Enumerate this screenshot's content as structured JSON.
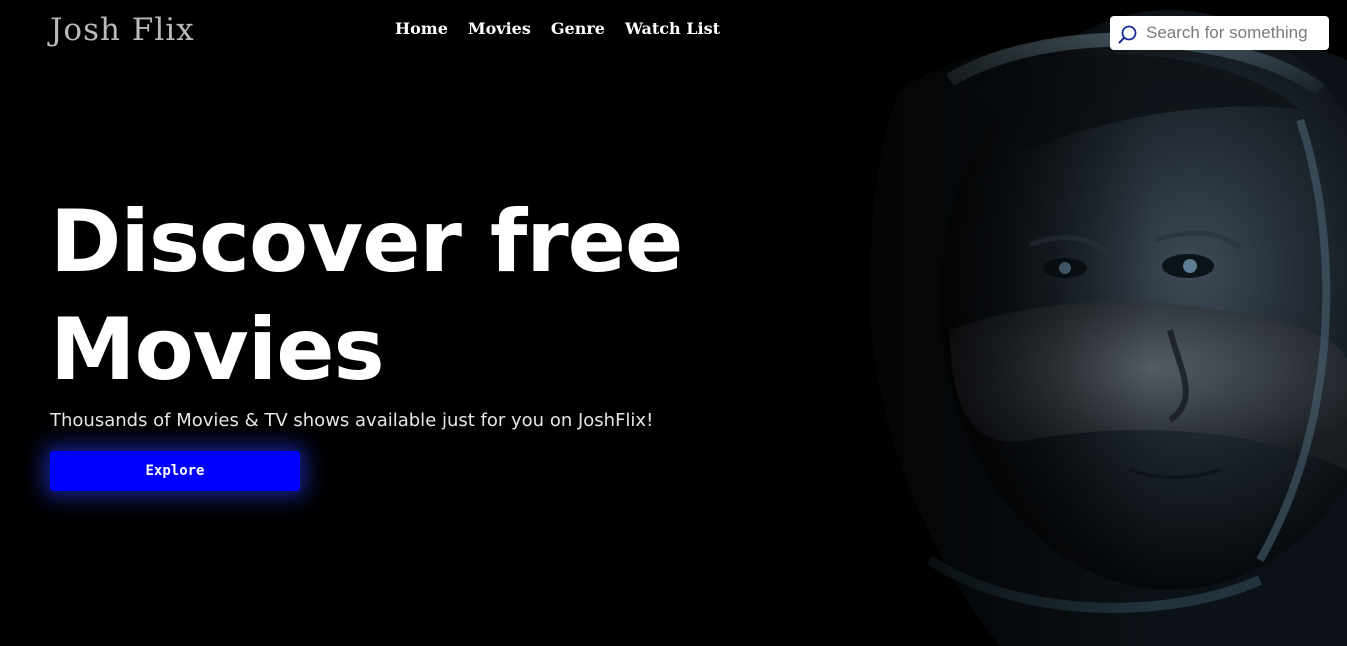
{
  "header": {
    "logo": "Josh Flix",
    "nav": [
      {
        "label": "Home"
      },
      {
        "label": "Movies"
      },
      {
        "label": "Genre"
      },
      {
        "label": "Watch List"
      }
    ],
    "search": {
      "placeholder": "Search for something",
      "value": "",
      "icon": "search-icon"
    }
  },
  "hero": {
    "title_line1": "Discover free",
    "title_line2": "Movies",
    "subtitle": "Thousands of Movies & TV shows available just for you on JoshFlix!",
    "cta_label": "Explore",
    "image": "astronaut-helmet-portrait"
  },
  "colors": {
    "background": "#000000",
    "accent": "#0000ff",
    "text": "#ffffff",
    "logo": "#b9b9b9"
  }
}
